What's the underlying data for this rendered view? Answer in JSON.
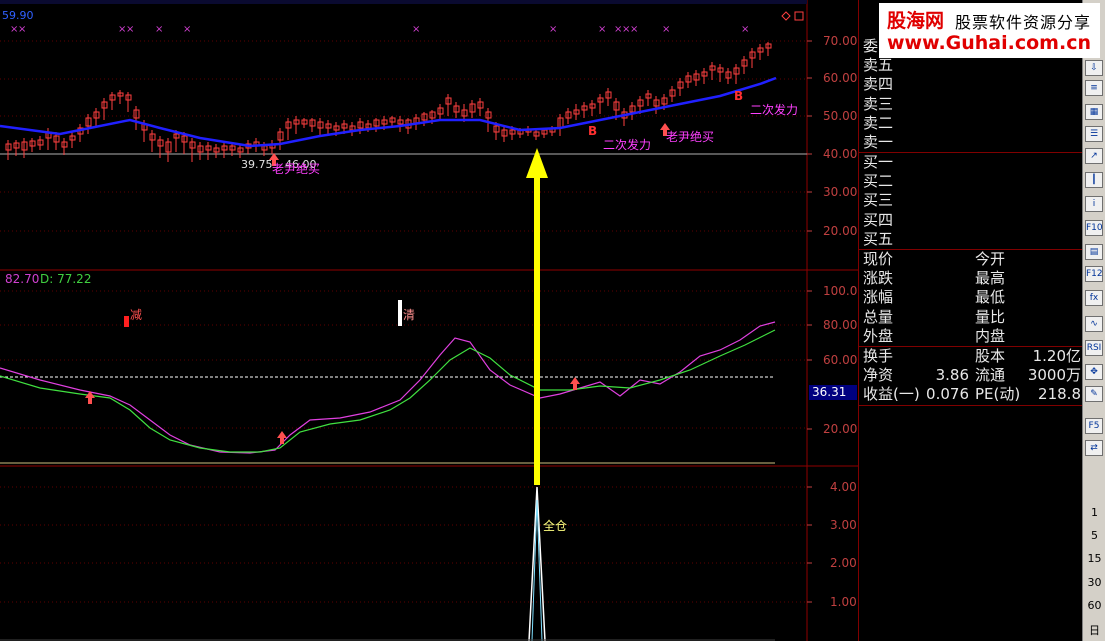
{
  "chart": {
    "top_label": "59.90",
    "kd_label_k": "82.70",
    "kd_label_d": "D: 77.22",
    "current_level": "36.31",
    "price_axis": [
      "70.00",
      "60.00",
      "50.00",
      "40.00",
      "30.00",
      "20.00"
    ],
    "kd_axis": [
      "100.00",
      "80.00",
      "60.00",
      "20.00"
    ],
    "signal_axis": [
      "4.00",
      "3.00",
      "2.00",
      "1.00"
    ],
    "annotations": {
      "low_price": "39.75",
      "low_price_right": "46.00",
      "buy1": "老尹绝买",
      "buy2": "老尹绝买",
      "second1": "二次发力",
      "second2": "二次发力",
      "b1": "B",
      "b2": "B",
      "reduce": "减",
      "clear": "清",
      "full": "全仓"
    }
  },
  "quote": {
    "asks": [
      "委",
      "卖五",
      "卖四",
      "卖三",
      "卖二",
      "卖一"
    ],
    "bids": [
      "买一",
      "买二",
      "买三",
      "买四",
      "买五"
    ],
    "stats_left": [
      "现价",
      "涨跌",
      "涨幅",
      "总量",
      "外盘"
    ],
    "stats_right": [
      "今开",
      "最高",
      "最低",
      "量比",
      "内盘"
    ],
    "fin": [
      {
        "l": "换手",
        "v": "",
        "r": "股本",
        "rv": "1.20亿"
      },
      {
        "l": "净资",
        "v": "3.86",
        "r": "流通",
        "rv": "3000万"
      },
      {
        "l": "收益(一)",
        "v": "0.076",
        "r": "PE(动)",
        "rv": "218.8"
      }
    ]
  },
  "logo": {
    "main": "股海网",
    "sub": "股票软件资源分享",
    "url": "www.Guhai.com.cn"
  },
  "toolbar": {
    "icons": [
      "arrow-icon",
      "list-icon",
      "table-icon",
      "list2-icon",
      "trend-icon",
      "candle-icon",
      "info-icon",
      "f10-icon",
      "chart-icon",
      "f12-icon",
      "fx-icon",
      "wave-icon",
      "rsi-icon",
      "move-icon",
      "pen-icon",
      "f5-icon",
      "swap-icon"
    ],
    "icon_text": [
      "⇩",
      "≡",
      "▦",
      "☰",
      "↗",
      "┃",
      "i",
      "F10",
      "▤",
      "F12",
      "fx",
      "∿",
      "RSI",
      "✥",
      "✎",
      "F5",
      "⇄"
    ],
    "periods": [
      "1",
      "5",
      "15",
      "30",
      "60",
      "日"
    ]
  }
}
